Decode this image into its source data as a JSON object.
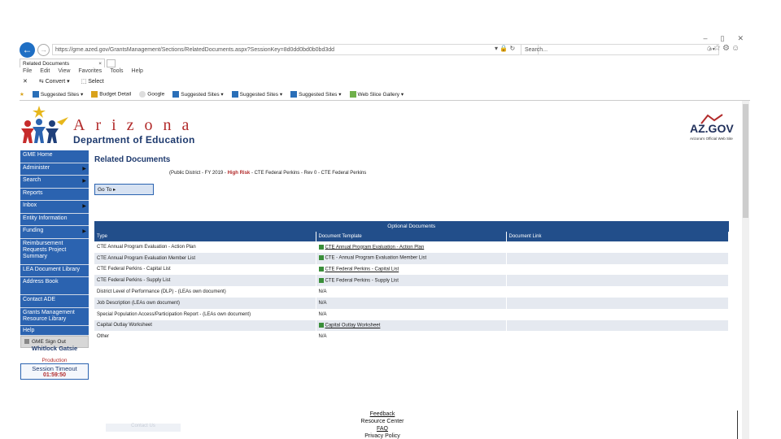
{
  "browser": {
    "window_controls": [
      "–",
      "▯",
      "✕"
    ],
    "url": "https://gme.azed.gov/GrantsManagement/Sections/RelatedDocuments.aspx?SessionKey=8d0dd0bd0b0bd3dd",
    "search_placeholder": "Search...",
    "tab_title": "Related Documents",
    "menu": [
      "File",
      "Edit",
      "View",
      "Favorites",
      "Tools",
      "Help"
    ],
    "commands": [
      "Convert",
      "Select"
    ],
    "favorites": [
      "Suggested Sites",
      "Budget Detail",
      "Google",
      "Suggested Sites",
      "Suggested Sites",
      "Suggested Sites",
      "Web Slice Gallery"
    ]
  },
  "header": {
    "org_title": "Arizona",
    "org_subtitle": "Department of Education",
    "azgov_logo": "AZ.GOV",
    "azgov_tagline": "Arizona's Official Web Site"
  },
  "sidebar": {
    "items": [
      {
        "label": "GME Home",
        "arrow": false
      },
      {
        "label": "Administer",
        "arrow": true
      },
      {
        "label": "Search",
        "arrow": true
      },
      {
        "label": "Reports",
        "arrow": false
      },
      {
        "label": "Inbox",
        "arrow": true
      },
      {
        "label": "Entity Information",
        "arrow": false
      },
      {
        "label": "Funding",
        "arrow": true
      },
      {
        "label": "Reimbursement Requests Project Summary",
        "arrow": false
      },
      {
        "label": "LEA Document Library",
        "arrow": false
      },
      {
        "label": "Address Book",
        "arrow": false
      },
      {
        "label": "Contact ADE",
        "arrow": false
      },
      {
        "label": "Grants Management Resource Library",
        "arrow": false
      },
      {
        "label": "Help",
        "arrow": false
      }
    ],
    "signout": "GME Sign Out",
    "user": "Whitlock Gatsie",
    "environment": "Production",
    "session_label": "Session Timeout",
    "session_time": "01:59:50"
  },
  "main": {
    "title": "Related Documents",
    "grant_prefix": "(Public District - FY 2019 -",
    "risk": "High Risk",
    "grant_suffix": "- CTE Federal Perkins - Rev 0 - CTE Federal Perkins",
    "goto_label": "Go To ▸"
  },
  "table": {
    "caption": "Optional Documents",
    "headers": [
      "Type",
      "Document Template",
      "Document Link"
    ],
    "rows": [
      {
        "type": "CTE Annual Program Evaluation - Action Plan",
        "template": "CTE Annual Program Evaluation - Action Plan",
        "link": true
      },
      {
        "type": "CTE Annual Program Evaluation Member List",
        "template": "CTE - Annual Program Evaluation Member List",
        "link": false
      },
      {
        "type": "CTE Federal Perkins - Capital List",
        "template": "CTE Federal Perkins - Capital List",
        "link": true
      },
      {
        "type": "CTE Federal Perkins - Supply List",
        "template": "CTE Federal Perkins - Supply List",
        "link": false
      },
      {
        "type": "District Level of Performance (DLP) - (LEAs own document)",
        "template": "N/A",
        "link": false
      },
      {
        "type": "Job Description (LEAs own document)",
        "template": "N/A",
        "link": false
      },
      {
        "type": "Special Population Access/Participation Report - (LEAs own document)",
        "template": "N/A",
        "link": false
      },
      {
        "type": "Capital Outlay Worksheet",
        "template": "Capital Outlay Worksheet",
        "link": true
      },
      {
        "type": "Other",
        "template": "N/A",
        "link": false
      }
    ]
  },
  "footer": {
    "links": [
      "Feedback",
      "Resource Center",
      "FAQ",
      "Privacy Policy"
    ],
    "faint": "Contact Us"
  }
}
